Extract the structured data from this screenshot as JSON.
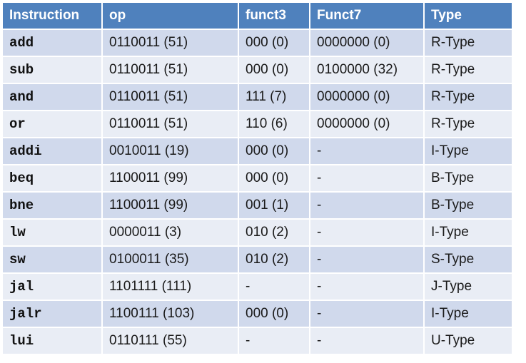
{
  "table": {
    "headers": [
      "Instruction",
      "op",
      "funct3",
      "Funct7",
      "Type"
    ],
    "rows": [
      [
        "add",
        "0110011 (51)",
        "000 (0)",
        "0000000 (0)",
        "R-Type"
      ],
      [
        "sub",
        "0110011 (51)",
        "000 (0)",
        "0100000 (32)",
        "R-Type"
      ],
      [
        "and",
        "0110011 (51)",
        "111 (7)",
        "0000000 (0)",
        "R-Type"
      ],
      [
        "or",
        "0110011 (51)",
        "110 (6)",
        "0000000 (0)",
        "R-Type"
      ],
      [
        "addi",
        "0010011 (19)",
        "000 (0)",
        "-",
        "I-Type"
      ],
      [
        "beq",
        "1100011 (99)",
        "000 (0)",
        "-",
        "B-Type"
      ],
      [
        "bne",
        "1100011 (99)",
        "001 (1)",
        "-",
        "B-Type"
      ],
      [
        "lw",
        "0000011 (3)",
        "010 (2)",
        "-",
        "I-Type"
      ],
      [
        "sw",
        "0100011 (35)",
        "010 (2)",
        "-",
        "S-Type"
      ],
      [
        "jal",
        "1101111 (111)",
        "-",
        "-",
        "J-Type"
      ],
      [
        "jalr",
        "1100111 (103)",
        "000 (0)",
        "-",
        "I-Type"
      ],
      [
        "lui",
        "0110111 (55)",
        "-",
        "-",
        "U-Type"
      ]
    ]
  },
  "colors": {
    "header_bg": "#4f81bd",
    "header_text": "#ffffff",
    "row_odd_bg": "#d0d9ec",
    "row_even_bg": "#e9edf5"
  }
}
